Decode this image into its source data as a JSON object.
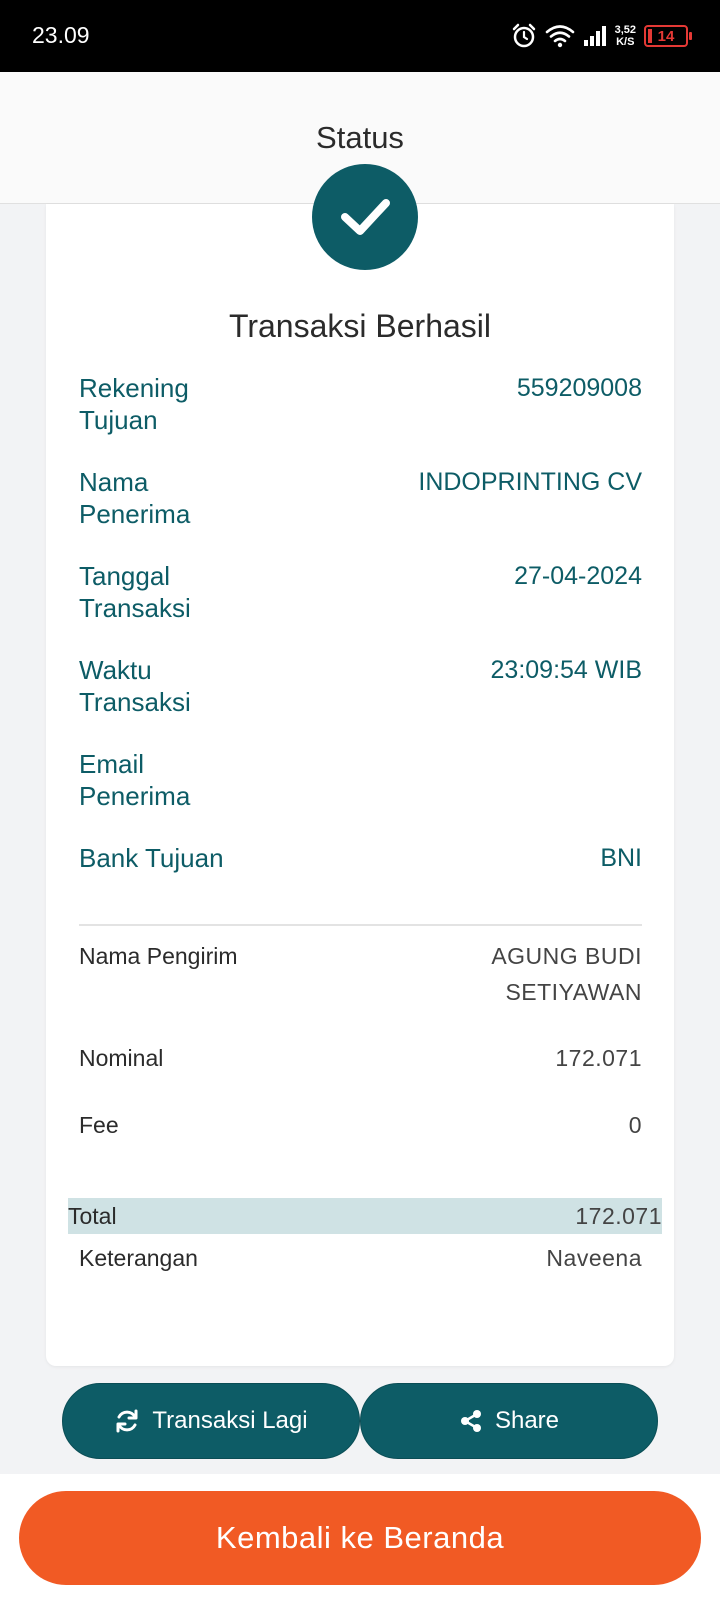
{
  "status_bar": {
    "time": "23.09",
    "net_speed_value": "3,52",
    "net_speed_unit": "K/S",
    "battery": "14",
    "icons": [
      "alarm-icon",
      "wifi-icon",
      "signal-icon"
    ]
  },
  "header": {
    "title": "Status"
  },
  "card": {
    "title": "Transaksi Berhasil",
    "details": [
      {
        "label": "Rekening Tujuan",
        "value": "559209008"
      },
      {
        "label": "Nama Penerima",
        "value": "INDOPRINTING CV"
      },
      {
        "label": "Tanggal Transaksi",
        "value": "27-04-2024"
      },
      {
        "label": "Waktu Transaksi",
        "value": "23:09:54 WIB"
      },
      {
        "label": "Email Penerima",
        "value": ""
      },
      {
        "label": "Bank Tujuan",
        "value": "BNI"
      }
    ],
    "sender_label": "Nama Pengirim",
    "sender_value_line1": "AGUNG BUDI",
    "sender_value_line2": "SETIYAWAN",
    "nominal_label": "Nominal",
    "nominal_value": "172.071",
    "fee_label": "Fee",
    "fee_value": "0",
    "total_label": "Total",
    "total_value": "172.071",
    "note_label": "Keterangan",
    "note_value": "Naveena"
  },
  "actions": {
    "again_label": "Transaksi Lagi",
    "share_label": "Share"
  },
  "home_button": {
    "label": "Kembali ke Beranda"
  },
  "colors": {
    "teal": "#0d5c66",
    "orange": "#f15a24",
    "total_highlight": "#cfe2e4",
    "battery_low": "#e53935"
  }
}
